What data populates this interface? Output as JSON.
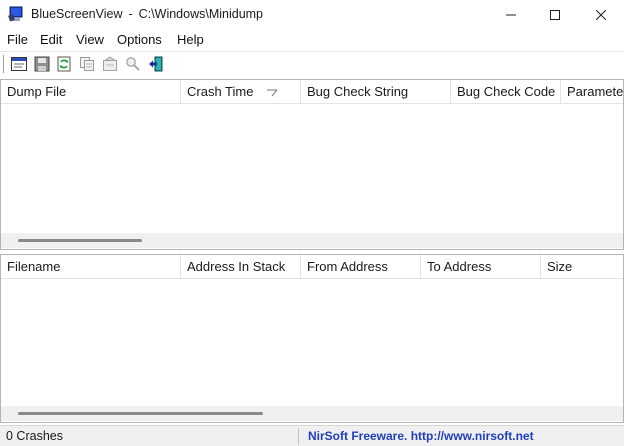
{
  "window": {
    "app_name": "BlueScreenView",
    "separator": "-",
    "path": "C:\\Windows\\Minidump"
  },
  "menu": [
    "File",
    "Edit",
    "View",
    "Options",
    "Help"
  ],
  "toolbar": {
    "buttons": [
      {
        "icon": "properties-icon"
      },
      {
        "icon": "save-icon"
      },
      {
        "icon": "refresh-icon"
      },
      {
        "icon": "copy-icon"
      },
      {
        "icon": "html-report-icon"
      },
      {
        "icon": "find-icon"
      },
      {
        "icon": "exit-icon"
      }
    ]
  },
  "crash_list": {
    "columns": [
      "Dump File",
      "Crash Time",
      "Bug Check String",
      "Bug Check Code",
      "Parameter"
    ],
    "sorted_column": "Crash Time",
    "rows": []
  },
  "driver_list": {
    "columns": [
      "Filename",
      "Address In Stack",
      "From Address",
      "To Address",
      "Size"
    ],
    "rows": []
  },
  "status": {
    "count": "0 Crashes",
    "nirsoft": "NirSoft Freeware.  http://www.nirsoft.net"
  },
  "colors": {
    "link_blue": "#1f3fbf",
    "app_icon_blue": "#1a3fb4"
  }
}
